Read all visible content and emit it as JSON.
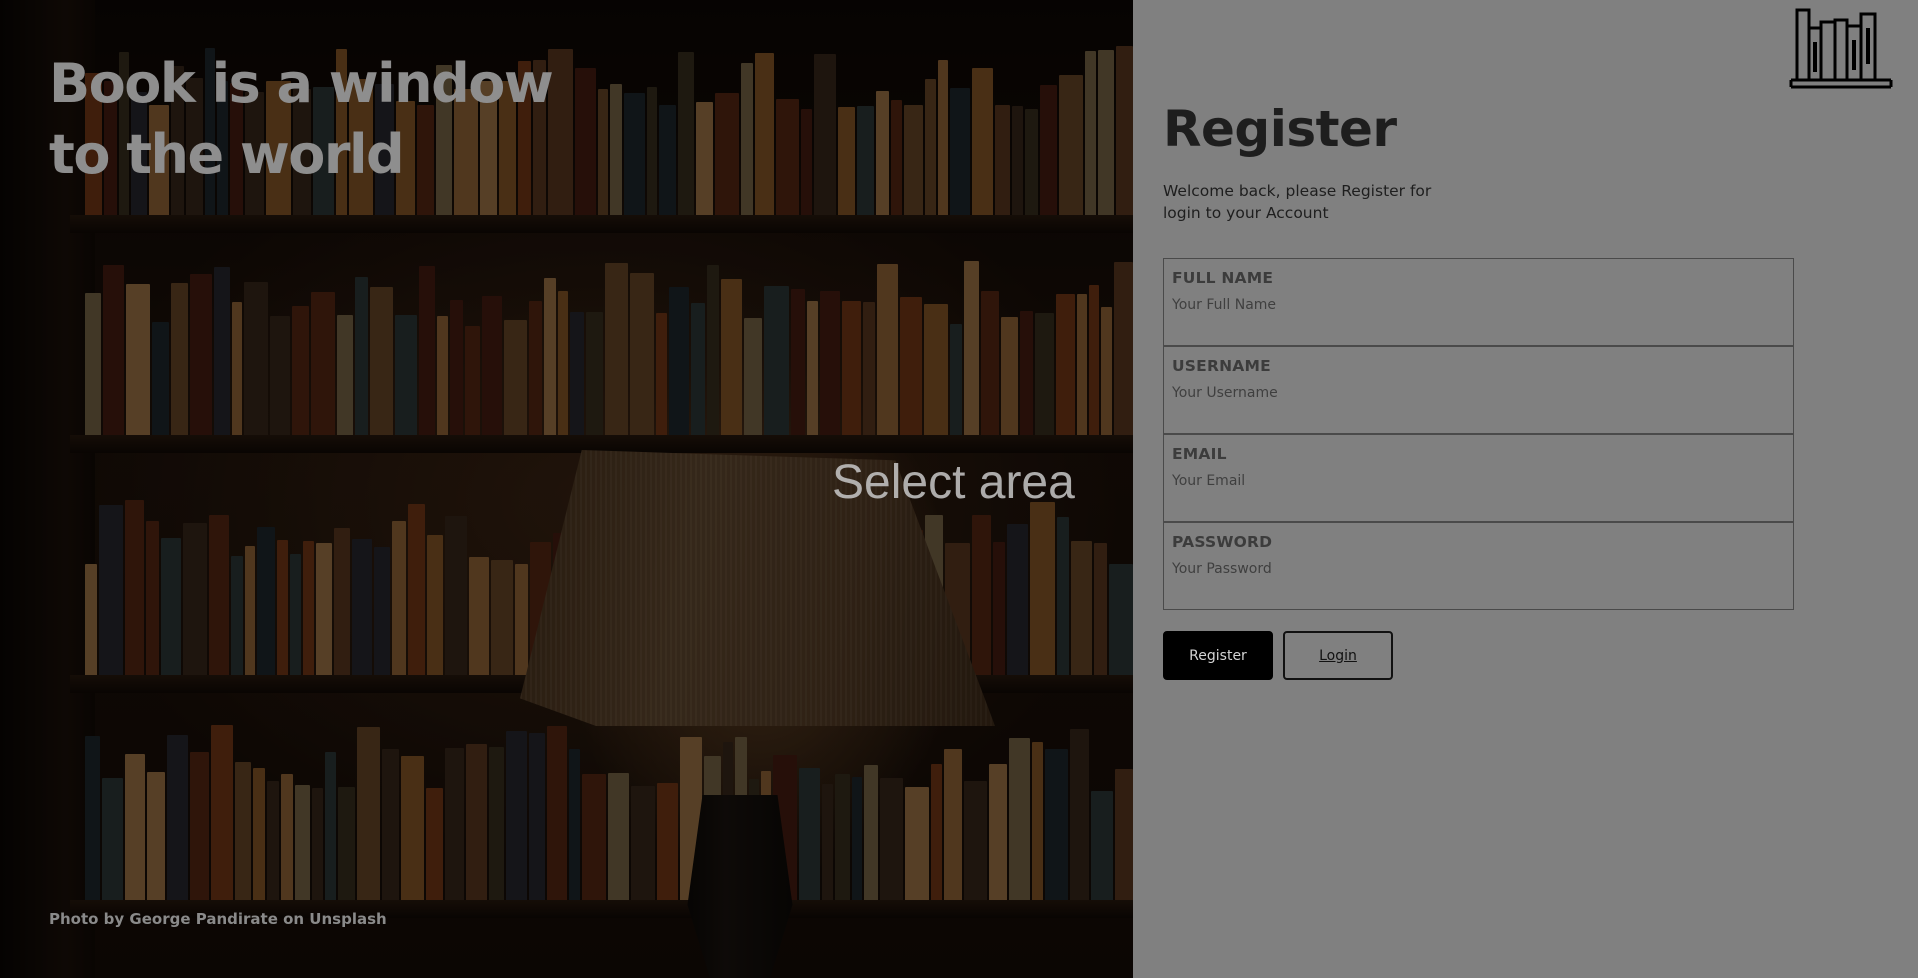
{
  "hero": {
    "title": "Book is a window\nto the world",
    "overlay_text": "Select area",
    "photo_credit": "Photo by George Pandirate on Unsplash"
  },
  "panel": {
    "logo_icon": "bookshelf-icon",
    "title": "Register",
    "subtitle": "Welcome back, please Register for login to your Account",
    "fields": [
      {
        "label": "FULL NAME",
        "placeholder": "Your Full Name",
        "value": ""
      },
      {
        "label": "USERNAME",
        "placeholder": "Your Username",
        "value": ""
      },
      {
        "label": "EMAIL",
        "placeholder": "Your Email",
        "value": ""
      },
      {
        "label": "PASSWORD",
        "placeholder": "Your Password",
        "value": ""
      }
    ],
    "register_label": "Register",
    "login_label": "Login"
  },
  "colors": {
    "panel_background": "#808080",
    "primary_button": "#000000",
    "text_dark": "#1e1e1e"
  }
}
